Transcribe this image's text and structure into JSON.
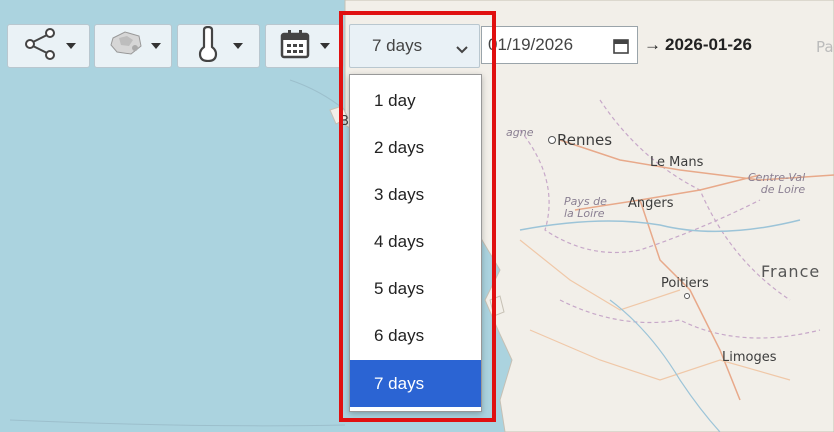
{
  "toolbar": {
    "share_icon": "share-icon",
    "layers_icon": "layers-icon",
    "variable_icon": "thermometer-icon",
    "calendar_icon": "calendar-icon"
  },
  "period": {
    "selected": "7 days",
    "options": [
      "1 day",
      "2 days",
      "3 days",
      "4 days",
      "5 days",
      "6 days",
      "7 days"
    ]
  },
  "date_range": {
    "start": "01/19/2026",
    "arrow": "→",
    "end": "2026-01-26"
  },
  "map": {
    "labels": {
      "rennes": "Rennes",
      "le_mans": "Le Mans",
      "angers": "Angers",
      "pays_de_la_loire_1": "Pays de",
      "pays_de_la_loire_2": "la Loire",
      "centre_val_de_loire_1": "Centre-Val",
      "centre_val_de_loire_2": "de Loire",
      "poitiers": "Poitiers",
      "limoges": "Limoges",
      "france": "France",
      "partial_paris": "Pari",
      "partial_bretagne": "agne",
      "partial_b": "B"
    },
    "colors": {
      "sea": "#abd3df",
      "land": "#f2efe9"
    }
  },
  "colors": {
    "selected_option": "#2b64d3",
    "highlight_border": "#e01010"
  }
}
